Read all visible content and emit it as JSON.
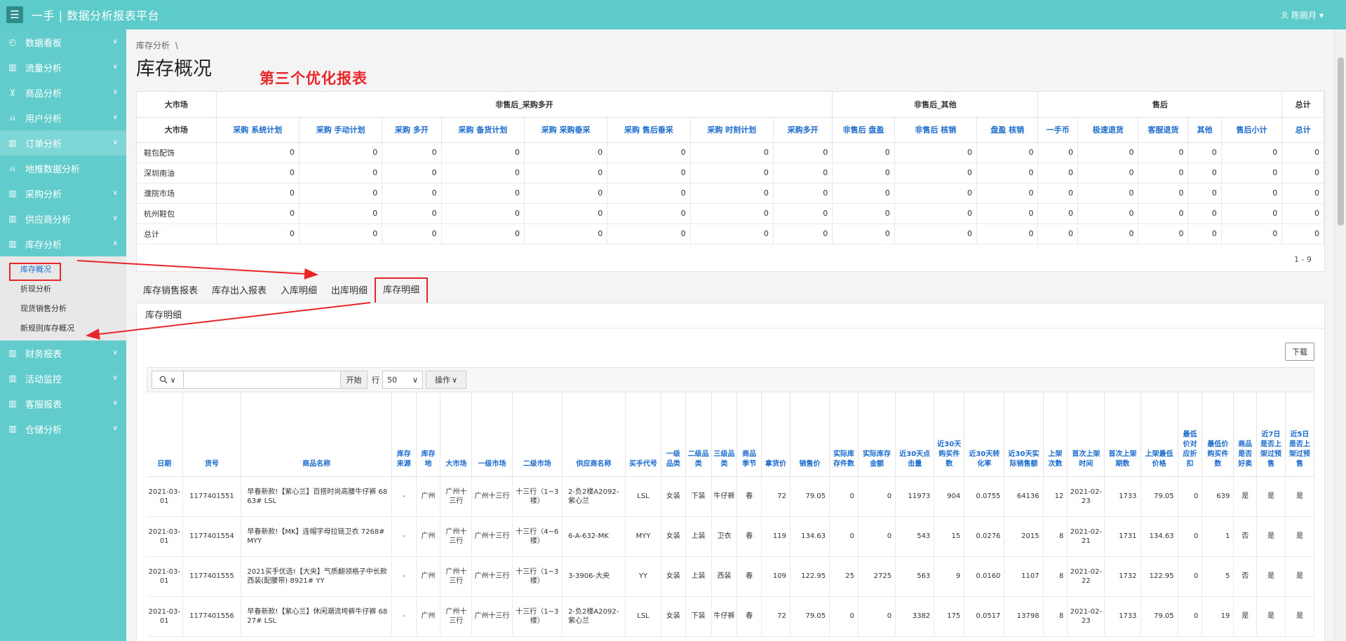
{
  "app": {
    "title": "一手 | 数据分析报表平台",
    "menu_icon": "☰",
    "user": "陈丽月"
  },
  "sidebar": {
    "items": [
      {
        "label": "数据看板",
        "icon": "dashboard-icon"
      },
      {
        "label": "流量分析",
        "icon": "bar-chart-icon"
      },
      {
        "label": "商品分析",
        "icon": "cart-icon"
      },
      {
        "label": "用户分析",
        "icon": "user-icon"
      },
      {
        "label": "订单分析",
        "icon": "bar-chart-icon"
      },
      {
        "label": "地推数据分析",
        "icon": "user-add-icon"
      },
      {
        "label": "采购分析",
        "icon": "bar-chart-icon"
      },
      {
        "label": "供应商分析",
        "icon": "bar-chart-icon"
      },
      {
        "label": "库存分析",
        "icon": "bar-chart-icon"
      }
    ],
    "sub_items": [
      "库存概况",
      "折现分析",
      "现货销售分析",
      "新规则库存概况"
    ],
    "items_after": [
      {
        "label": "财务报表",
        "icon": "bar-chart-icon"
      },
      {
        "label": "活动监控",
        "icon": "bar-chart-icon"
      },
      {
        "label": "客服报表",
        "icon": "bar-chart-icon"
      },
      {
        "label": "仓储分析",
        "icon": "bar-chart-icon"
      }
    ]
  },
  "page": {
    "breadcrumb": "库存分析",
    "breadcrumb_sep": "\\",
    "title": "库存概况",
    "annotation": "第三个优化报表"
  },
  "summary": {
    "group_headers": [
      "大市场",
      "非售后_采购多开",
      "非售后_其他",
      "售后",
      "总计"
    ],
    "columns": [
      "大市场",
      "采购 系统计划",
      "采购 手动计划",
      "采购 多开",
      "采购 备货计划",
      "采购 采购垂采",
      "采购 售后垂采",
      "采购 时刻计划",
      "采购多开",
      "非售后 盘盈",
      "非售后 核销",
      "盘盈 核销",
      "一手币",
      "极速退货",
      "客服退货",
      "其他",
      "售后小计",
      "总计"
    ],
    "rows": [
      {
        "label": "鞋包配饰",
        "values": [
          "0",
          "0",
          "0",
          "0",
          "0",
          "0",
          "0",
          "0",
          "0",
          "0",
          "0",
          "0",
          "0",
          "0",
          "0",
          "0",
          "0"
        ]
      },
      {
        "label": "深圳南油",
        "values": [
          "0",
          "0",
          "0",
          "0",
          "0",
          "0",
          "0",
          "0",
          "0",
          "0",
          "0",
          "0",
          "0",
          "0",
          "0",
          "0",
          "0"
        ]
      },
      {
        "label": "濮院市场",
        "values": [
          "0",
          "0",
          "0",
          "0",
          "0",
          "0",
          "0",
          "0",
          "0",
          "0",
          "0",
          "0",
          "0",
          "0",
          "0",
          "0",
          "0"
        ]
      },
      {
        "label": "杭州鞋包",
        "values": [
          "0",
          "0",
          "0",
          "0",
          "0",
          "0",
          "0",
          "0",
          "0",
          "0",
          "0",
          "0",
          "0",
          "0",
          "0",
          "0",
          "0"
        ]
      },
      {
        "label": "总计",
        "values": [
          "0",
          "0",
          "0",
          "0",
          "0",
          "0",
          "0",
          "0",
          "0",
          "0",
          "0",
          "0",
          "0",
          "0",
          "0",
          "0",
          "0"
        ]
      }
    ],
    "pager": "1 - 9"
  },
  "tabs": [
    "库存销售报表",
    "库存出入报表",
    "入库明细",
    "出库明细",
    "库存明细"
  ],
  "detail": {
    "title": "库存明细",
    "download": "下载",
    "search_placeholder": "",
    "go": "开始",
    "rows_label": "行",
    "rows_value": "50",
    "actions": "操作",
    "columns": [
      "日期",
      "货号",
      "商品名称",
      "库存来源",
      "库存地",
      "大市场",
      "一级市场",
      "二级市场",
      "供应商名称",
      "买手代号",
      "一级品类",
      "二级品类",
      "三级品类",
      "商品季节",
      "拿货价",
      "销售价",
      "实际库存件数",
      "实际库存金额",
      "近30天点击量",
      "近30天购买件数",
      "近30天转化率",
      "近30天实际销售额",
      "上架次数",
      "首次上架时间",
      "首次上架期数",
      "上架最低价格",
      "最低价对应折扣",
      "最低价购买件数",
      "商品是否好卖",
      "近7日是否上架过预售",
      "近5日是否上架过预售"
    ],
    "rows": [
      [
        "2021-03-01",
        "1177401551",
        "早春新款!【紫心兰】百搭时尚高腰牛仔裤 6863# LSL",
        "-",
        "广州",
        "广州十三行",
        "广州十三行",
        "十三行（1~3楼）",
        "2-负2楼A2092-紫心兰",
        "LSL",
        "女装",
        "下装",
        "牛仔裤",
        "春",
        "72",
        "79.05",
        "0",
        "0",
        "11973",
        "904",
        "0.0755",
        "64136",
        "12",
        "2021-02-23",
        "1733",
        "79.05",
        "0",
        "639",
        "是",
        "是",
        "是"
      ],
      [
        "2021-03-01",
        "1177401554",
        "早春新款!【MK】连帽字母拉链卫衣 7268# MYY",
        "-",
        "广州",
        "广州十三行",
        "广州十三行",
        "十三行（4~6楼）",
        "6-A-632-MK",
        "MYY",
        "女装",
        "上装",
        "卫衣",
        "春",
        "119",
        "134.63",
        "0",
        "0",
        "543",
        "15",
        "0.0276",
        "2015",
        "8",
        "2021-02-21",
        "1731",
        "134.63",
        "0",
        "1",
        "否",
        "是",
        "是"
      ],
      [
        "2021-03-01",
        "1177401555",
        "2021买手优选!【大央】气质翻领格子中长款西装(配腰带) 8921# YY",
        "-",
        "广州",
        "广州十三行",
        "广州十三行",
        "十三行（1~3楼）",
        "3-3906-大央",
        "YY",
        "女装",
        "上装",
        "西装",
        "春",
        "109",
        "122.95",
        "25",
        "2725",
        "563",
        "9",
        "0.0160",
        "1107",
        "8",
        "2021-02-22",
        "1732",
        "122.95",
        "0",
        "5",
        "否",
        "是",
        "是"
      ],
      [
        "2021-03-01",
        "1177401556",
        "早春新款!【紫心兰】休闲潮流垮裤牛仔裤 6827# LSL",
        "-",
        "广州",
        "广州十三行",
        "广州十三行",
        "十三行（1~3楼）",
        "2-负2楼A2092-紫心兰",
        "LSL",
        "女装",
        "下装",
        "牛仔裤",
        "春",
        "72",
        "79.05",
        "0",
        "0",
        "3382",
        "175",
        "0.0517",
        "13798",
        "8",
        "2021-02-23",
        "1733",
        "79.05",
        "0",
        "19",
        "是",
        "是",
        "是"
      ]
    ]
  },
  "colors": {
    "teal": "#5ecbcb",
    "link_blue": "#1a6bcc",
    "annotation_red": "#e8262a"
  }
}
